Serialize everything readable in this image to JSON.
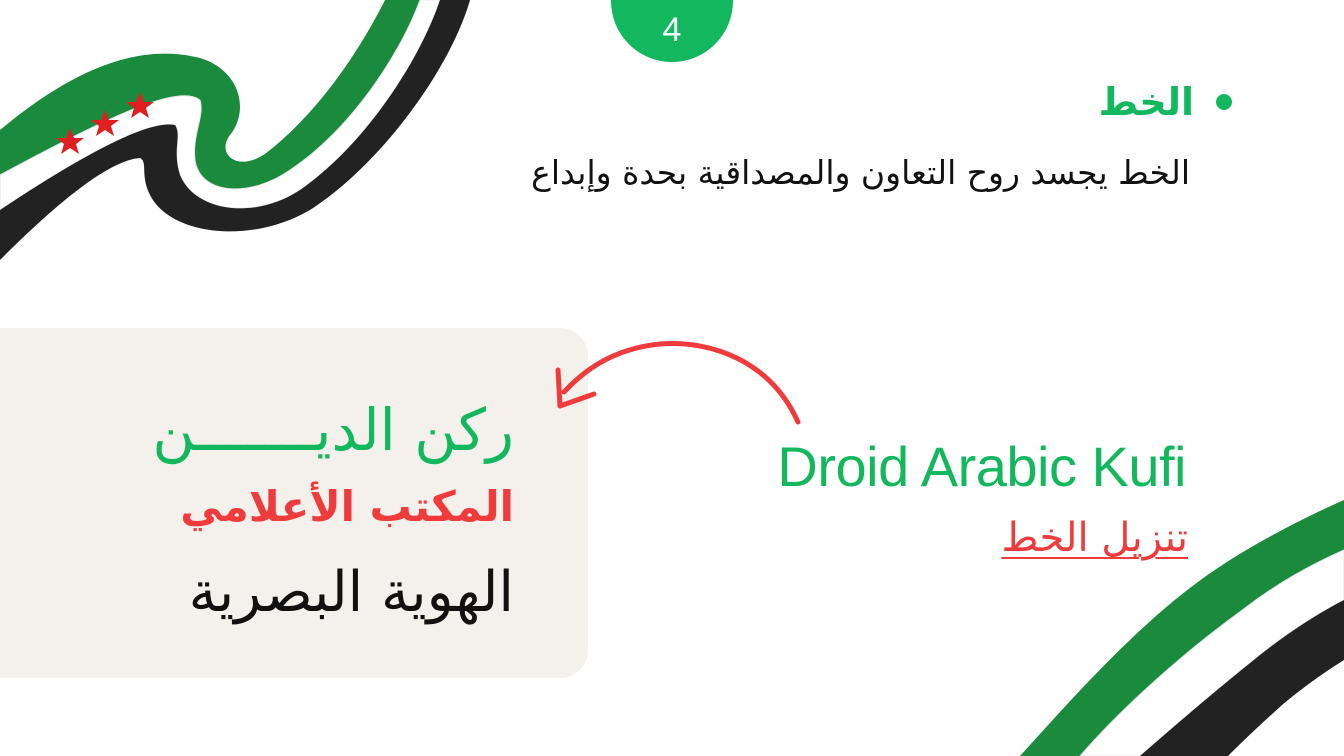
{
  "page_number": "4",
  "section": {
    "title": "الخط",
    "description": "الخط يجسد روح التعاون والمصداقية بحدة وإبداع"
  },
  "card": {
    "line1": "ركن الديـــــــن",
    "line2": "المكتب الأعلامي",
    "line3": "الهوية البصرية"
  },
  "font": {
    "name": "Droid Arabic Kufi",
    "download_label": "تنزيل الخط"
  },
  "colors": {
    "accent_green": "#13b85e",
    "accent_red": "#ef3b3b",
    "card_bg": "#f4f1ec",
    "flag_green": "#1a8a3c",
    "flag_black": "#222222"
  },
  "icons": {
    "arrow": "curved-arrow-icon",
    "flag": "syrian-flag-ribbon"
  }
}
